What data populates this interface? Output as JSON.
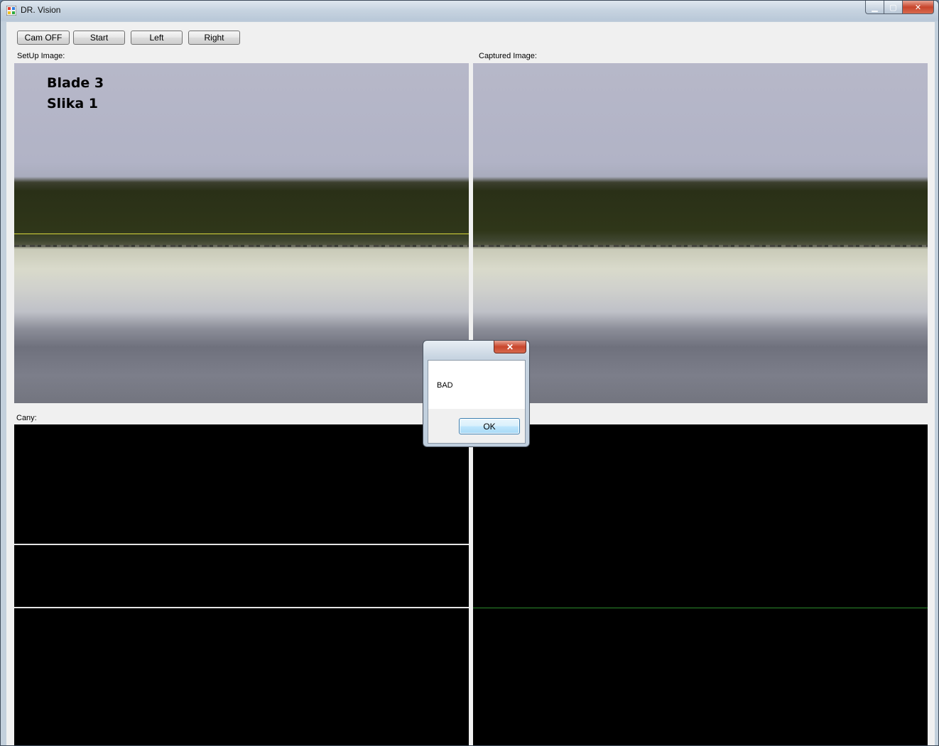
{
  "window": {
    "title": "DR. Vision"
  },
  "caption": {
    "minimize": "▁",
    "maximize": "▢",
    "close": "✕"
  },
  "toolbar": {
    "cam_off": "Cam OFF",
    "start": "Start",
    "left": "Left",
    "right": "Right"
  },
  "labels": {
    "setup_image": "SetUp Image:",
    "captured_image": "Captured Image:",
    "cany": "Cany:"
  },
  "setup_overlay": {
    "line1": "Blade 3",
    "line2": "Slika 1"
  },
  "dialog": {
    "close": "✕",
    "message": "BAD",
    "ok": "OK"
  },
  "icons": {
    "app": "app-icon"
  },
  "colors": {
    "accent_close": "#c8452c",
    "edge_green": "#2c8a2c",
    "guide_yellow": "#d8d83a"
  }
}
